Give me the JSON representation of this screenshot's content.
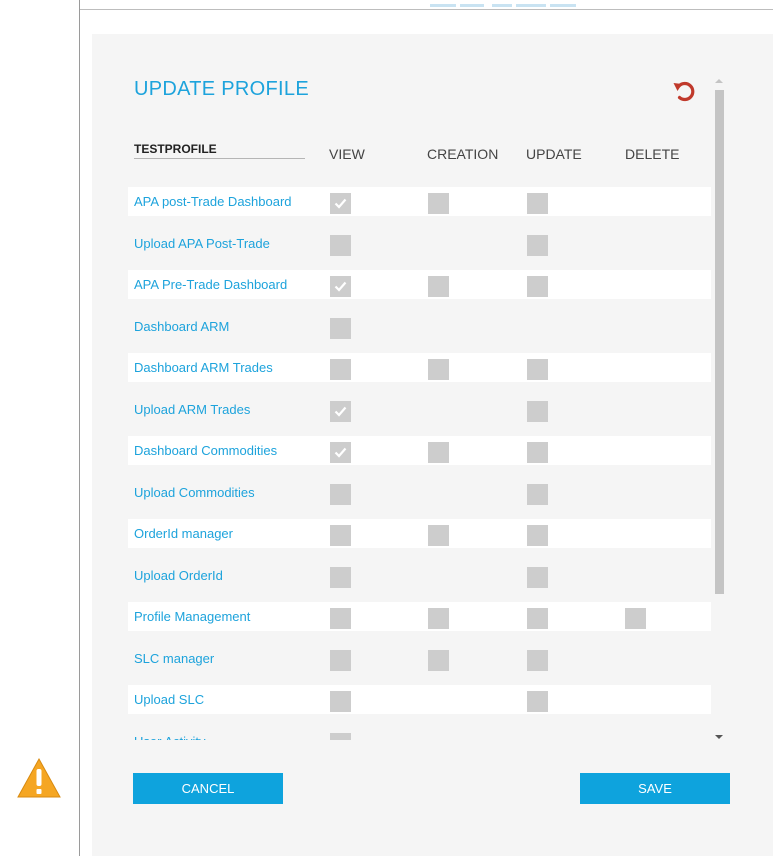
{
  "dialog": {
    "title": "UPDATE PROFILE",
    "refresh_icon": "refresh-icon",
    "profile_name": "TESTPROFILE",
    "columns": [
      "VIEW",
      "CREATION",
      "UPDATE",
      "DELETE"
    ],
    "rows": [
      {
        "label": "APA post-Trade Dashboard",
        "view": true,
        "creation": false,
        "update": false,
        "delete": null
      },
      {
        "label": "Upload APA Post-Trade",
        "view": false,
        "creation": null,
        "update": false,
        "delete": null
      },
      {
        "label": "APA Pre-Trade Dashboard",
        "view": true,
        "creation": false,
        "update": false,
        "delete": null
      },
      {
        "label": "Dashboard ARM",
        "view": false,
        "creation": null,
        "update": null,
        "delete": null
      },
      {
        "label": "Dashboard ARM Trades",
        "view": false,
        "creation": false,
        "update": false,
        "delete": null
      },
      {
        "label": "Upload ARM Trades",
        "view": true,
        "creation": null,
        "update": false,
        "delete": null
      },
      {
        "label": "Dashboard Commodities",
        "view": true,
        "creation": false,
        "update": false,
        "delete": null
      },
      {
        "label": "Upload Commodities",
        "view": false,
        "creation": null,
        "update": false,
        "delete": null
      },
      {
        "label": "OrderId manager",
        "view": false,
        "creation": false,
        "update": false,
        "delete": null
      },
      {
        "label": "Upload OrderId",
        "view": false,
        "creation": null,
        "update": false,
        "delete": null
      },
      {
        "label": "Profile Management",
        "view": false,
        "creation": false,
        "update": false,
        "delete": false
      },
      {
        "label": "SLC manager",
        "view": false,
        "creation": false,
        "update": false,
        "delete": null
      },
      {
        "label": "Upload SLC",
        "view": false,
        "creation": null,
        "update": false,
        "delete": null
      },
      {
        "label": "User Activity",
        "view": false,
        "creation": null,
        "update": null,
        "delete": null
      }
    ],
    "cancel_label": "CANCEL",
    "save_label": "SAVE"
  },
  "warning_icon": "warning-icon",
  "colors": {
    "accent": "#1da3dc",
    "button": "#0ea3dd",
    "refresh": "#c0392b",
    "checkbox": "#cdcdcd",
    "warning": "#f5a623"
  }
}
